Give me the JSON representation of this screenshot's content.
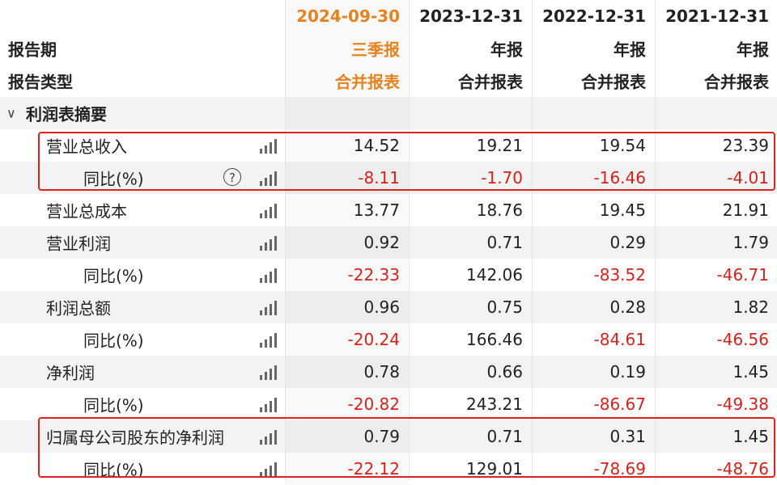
{
  "periods": [
    {
      "date": "2024-09-30",
      "report": "三季报",
      "type": "合并报表",
      "accent": "#e8821e"
    },
    {
      "date": "2023-12-31",
      "report": "年报",
      "type": "合并报表"
    },
    {
      "date": "2022-12-31",
      "report": "年报",
      "type": "合并报表"
    },
    {
      "date": "2021-12-31",
      "report": "年报",
      "type": "合并报表"
    }
  ],
  "header": {
    "period_label": "报告期",
    "type_label": "报告类型"
  },
  "section": {
    "title": "利润表摘要",
    "expand_icon": "chevron-down-icon"
  },
  "rows": [
    {
      "label": "营业总收入",
      "level": 1,
      "values": [
        "14.52",
        "19.21",
        "19.54",
        "23.39"
      ]
    },
    {
      "label": "同比(%)",
      "level": 2,
      "help": true,
      "values": [
        "-8.11",
        "-1.70",
        "-16.46",
        "-4.01"
      ]
    },
    {
      "label": "营业总成本",
      "level": 1,
      "values": [
        "13.77",
        "18.76",
        "19.45",
        "21.91"
      ]
    },
    {
      "label": "营业利润",
      "level": 1,
      "values": [
        "0.92",
        "0.71",
        "0.29",
        "1.79"
      ]
    },
    {
      "label": "同比(%)",
      "level": 2,
      "values": [
        "-22.33",
        "142.06",
        "-83.52",
        "-46.71"
      ]
    },
    {
      "label": "利润总额",
      "level": 1,
      "values": [
        "0.96",
        "0.75",
        "0.28",
        "1.82"
      ]
    },
    {
      "label": "同比(%)",
      "level": 2,
      "values": [
        "-20.24",
        "166.46",
        "-84.61",
        "-46.56"
      ]
    },
    {
      "label": "净利润",
      "level": 1,
      "values": [
        "0.78",
        "0.66",
        "0.19",
        "1.45"
      ]
    },
    {
      "label": "同比(%)",
      "level": 2,
      "values": [
        "-20.82",
        "243.21",
        "-86.67",
        "-49.38"
      ]
    },
    {
      "label": "归属母公司股东的净利润",
      "level": 1,
      "values": [
        "0.79",
        "0.71",
        "0.31",
        "1.45"
      ]
    },
    {
      "label": "同比(%)",
      "level": 2,
      "values": [
        "-22.12",
        "129.01",
        "-78.69",
        "-48.76"
      ]
    }
  ],
  "colors": {
    "negative": "#d7221b",
    "highlight_box": "#e0221e",
    "row_shade": "#f3f3f3"
  }
}
